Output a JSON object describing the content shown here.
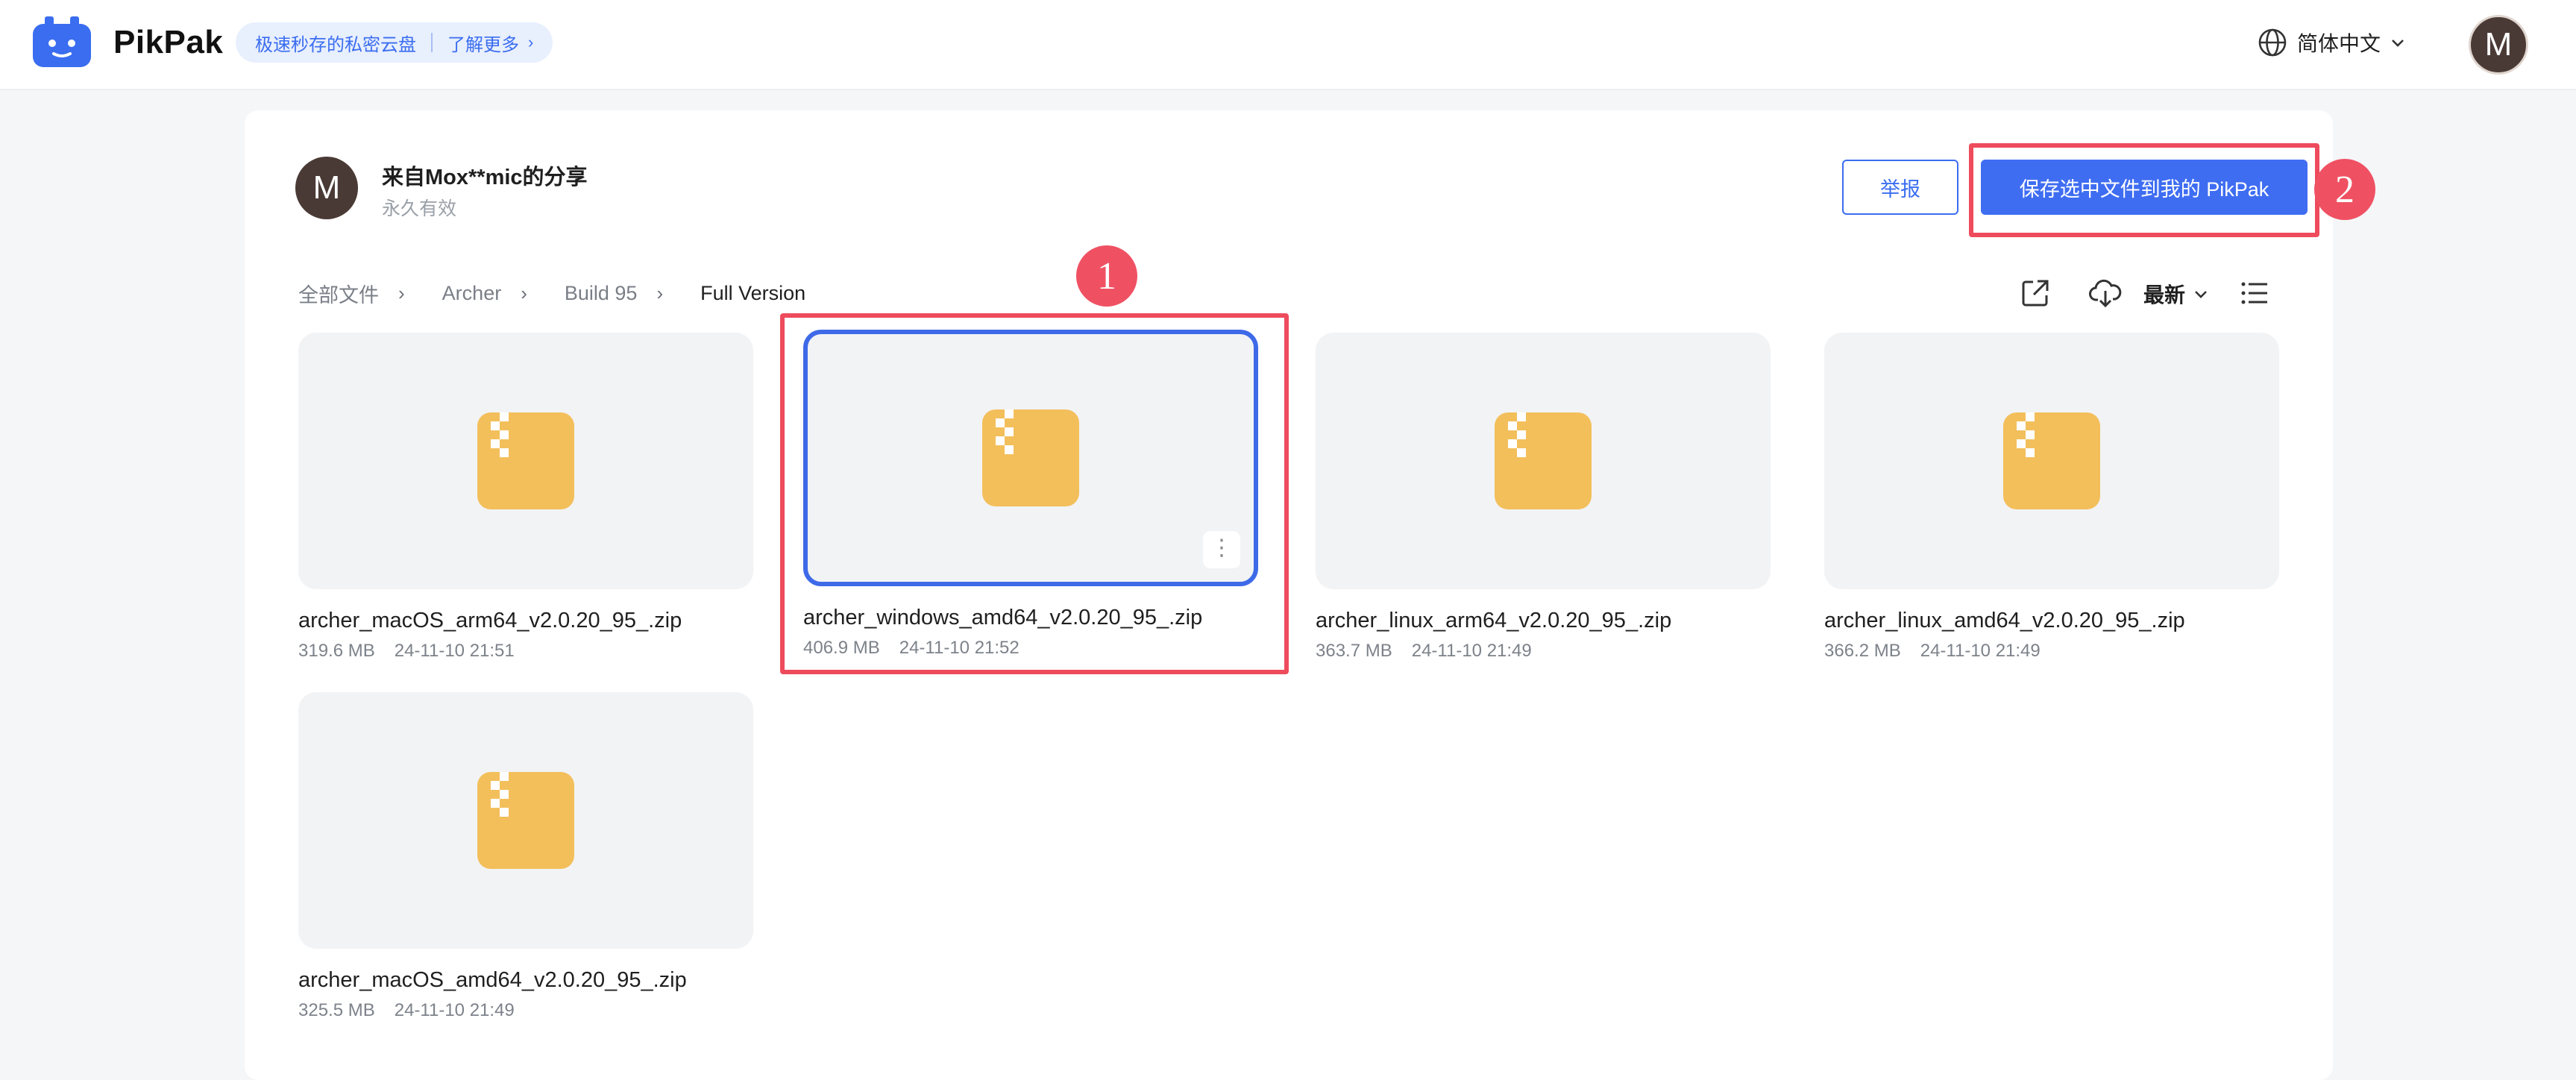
{
  "header": {
    "brand": "PikPak",
    "promo_text": "极速秒存的私密云盘",
    "promo_link": "了解更多",
    "language": "简体中文",
    "avatar_letter": "M"
  },
  "share": {
    "avatar_letter": "M",
    "title": "来自Mox**mic的分享",
    "validity": "永久有效",
    "report_label": "举报",
    "save_label": "保存选中文件到我的 PikPak"
  },
  "breadcrumb": [
    "全部文件",
    "Archer",
    "Build 95",
    "Full Version"
  ],
  "toolbar": {
    "sort_label": "最新"
  },
  "files": [
    {
      "name": "archer_macOS_arm64_v2.0.20_95_.zip",
      "size": "319.6 MB",
      "date": "24-11-10 21:51",
      "selected": false
    },
    {
      "name": "archer_windows_amd64_v2.0.20_95_.zip",
      "size": "406.9 MB",
      "date": "24-11-10 21:52",
      "selected": true
    },
    {
      "name": "archer_linux_arm64_v2.0.20_95_.zip",
      "size": "363.7 MB",
      "date": "24-11-10 21:49",
      "selected": false
    },
    {
      "name": "archer_linux_amd64_v2.0.20_95_.zip",
      "size": "366.2 MB",
      "date": "24-11-10 21:49",
      "selected": false
    },
    {
      "name": "archer_macOS_amd64_v2.0.20_95_.zip",
      "size": "325.5 MB",
      "date": "24-11-10 21:49",
      "selected": false
    }
  ],
  "annotations": [
    "1",
    "2"
  ],
  "colors": {
    "accent": "#3f6df2",
    "zip_icon": "#f3bf5b",
    "annotation": "#ef5163"
  },
  "icons": [
    "pikpak-logo-icon",
    "globe-icon",
    "chevron-down-icon",
    "external-link-icon",
    "download-icon",
    "list-view-icon",
    "zip-file-icon",
    "more-vertical-icon"
  ]
}
